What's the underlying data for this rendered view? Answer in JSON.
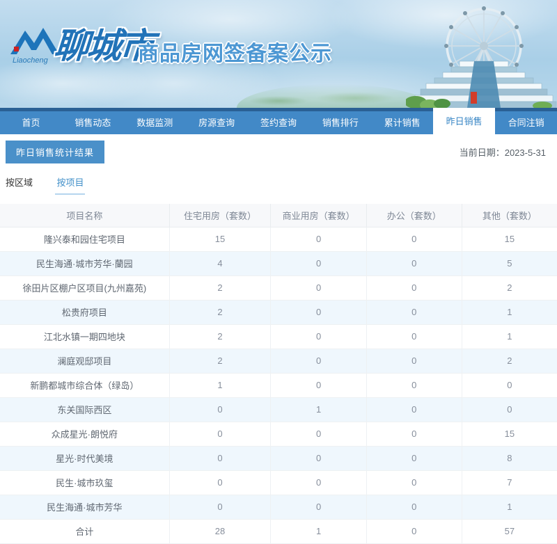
{
  "banner": {
    "logo_script": "Liaocheng",
    "city_name": "聊城市",
    "subtitle": "商品房网签备案公示"
  },
  "nav": {
    "items": [
      {
        "label": "首页",
        "active": false
      },
      {
        "label": "销售动态",
        "active": false
      },
      {
        "label": "数据监测",
        "active": false
      },
      {
        "label": "房源查询",
        "active": false
      },
      {
        "label": "签约查询",
        "active": false
      },
      {
        "label": "销售排行",
        "active": false
      },
      {
        "label": "累计销售",
        "active": false
      },
      {
        "label": "昨日销售",
        "active": true
      },
      {
        "label": "合同注销",
        "active": false
      }
    ]
  },
  "page": {
    "section_title": "昨日销售统计结果",
    "date_label": "当前日期：",
    "date_value": "2023-5-31",
    "tabs": [
      {
        "label": "按区域",
        "active": false
      },
      {
        "label": "按项目",
        "active": true
      }
    ]
  },
  "table": {
    "columns": [
      "项目名称",
      "住宅用房（套数）",
      "商业用房（套数）",
      "办公（套数）",
      "其他（套数）"
    ],
    "rows": [
      [
        "隆兴泰和园住宅项目",
        "15",
        "0",
        "0",
        "15"
      ],
      [
        "民生海通·城市芳华·蘭园",
        "4",
        "0",
        "0",
        "5"
      ],
      [
        "徐田片区棚户区项目(九州嘉苑)",
        "2",
        "0",
        "0",
        "2"
      ],
      [
        "松贵府项目",
        "2",
        "0",
        "0",
        "1"
      ],
      [
        "江北水镇一期四地块",
        "2",
        "0",
        "0",
        "1"
      ],
      [
        "澜庭观邸项目",
        "2",
        "0",
        "0",
        "2"
      ],
      [
        "新鹏都城市综合体（绿岛）",
        "1",
        "0",
        "0",
        "0"
      ],
      [
        "东关国际西区",
        "0",
        "1",
        "0",
        "0"
      ],
      [
        "众成星光·朗悦府",
        "0",
        "0",
        "0",
        "15"
      ],
      [
        "星光·时代美境",
        "0",
        "0",
        "0",
        "8"
      ],
      [
        "民生·城市玖玺",
        "0",
        "0",
        "0",
        "7"
      ],
      [
        "民生海通·城市芳华",
        "0",
        "0",
        "0",
        "1"
      ],
      [
        "合计",
        "28",
        "1",
        "0",
        "57"
      ]
    ]
  },
  "colors": {
    "nav_blue": "#4289c7",
    "nav_dark_strip": "#2a6094",
    "accent_blue": "#4a90c9",
    "row_alt": "#eff7fd",
    "header_bg": "#f7f8fa"
  }
}
